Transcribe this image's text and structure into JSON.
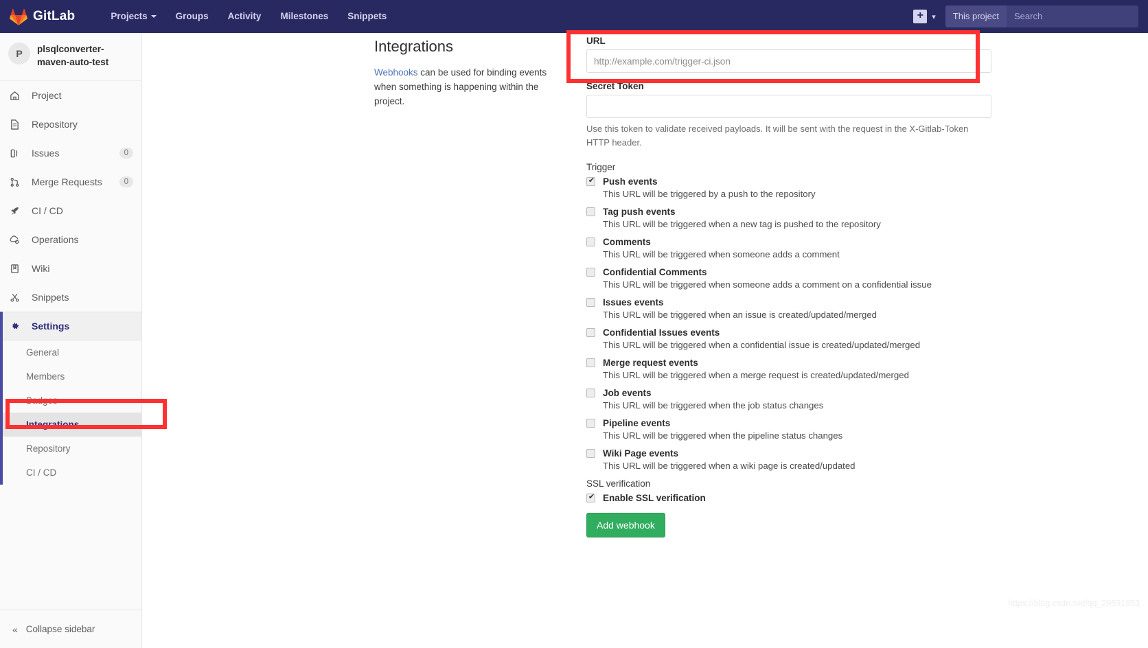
{
  "navbar": {
    "brand": "GitLab",
    "logo_icon": "gitlab-fox-logo",
    "links": [
      {
        "label": "Projects",
        "has_caret": true
      },
      {
        "label": "Groups",
        "has_caret": false
      },
      {
        "label": "Activity",
        "has_caret": false
      },
      {
        "label": "Milestones",
        "has_caret": false
      },
      {
        "label": "Snippets",
        "has_caret": false
      }
    ],
    "plus_icon": "plus-square-icon",
    "plus_caret_icon": "chevron-down-icon",
    "search_scope": "This project",
    "search_placeholder": "Search"
  },
  "sidebar": {
    "project_initial": "P",
    "project_name": "plsqlconverter-maven-auto-test",
    "items": [
      {
        "label": "Project",
        "icon": "home-icon",
        "count": null
      },
      {
        "label": "Repository",
        "icon": "document-icon",
        "count": null
      },
      {
        "label": "Issues",
        "icon": "issues-icon",
        "count": "0"
      },
      {
        "label": "Merge Requests",
        "icon": "merge-request-icon",
        "count": "0"
      },
      {
        "label": "CI / CD",
        "icon": "rocket-icon",
        "count": null
      },
      {
        "label": "Operations",
        "icon": "cloud-gear-icon",
        "count": null
      },
      {
        "label": "Wiki",
        "icon": "book-icon",
        "count": null
      },
      {
        "label": "Snippets",
        "icon": "scissors-icon",
        "count": null
      },
      {
        "label": "Settings",
        "icon": "gear-icon",
        "count": null,
        "active": true
      }
    ],
    "settings_subitems": [
      {
        "label": "General",
        "current": false
      },
      {
        "label": "Members",
        "current": false
      },
      {
        "label": "Badges",
        "current": false
      },
      {
        "label": "Integrations",
        "current": true
      },
      {
        "label": "Repository",
        "current": false
      },
      {
        "label": "CI / CD",
        "current": false
      }
    ],
    "collapse_label": "Collapse sidebar",
    "collapse_icon": "double-chevron-left-icon"
  },
  "main": {
    "page_title": "Integrations",
    "intro_link": "Webhooks",
    "intro_text": " can be used for binding events when something is happening within the project.",
    "url_label": "URL",
    "url_value": "",
    "url_placeholder": "http://example.com/trigger-ci.json",
    "secret_token_label": "Secret Token",
    "secret_token_value": "",
    "secret_token_help": "Use this token to validate received payloads. It will be sent with the request in the X-Gitlab-Token HTTP header.",
    "trigger_label": "Trigger",
    "triggers": [
      {
        "title": "Push events",
        "desc": "This URL will be triggered by a push to the repository",
        "checked": true
      },
      {
        "title": "Tag push events",
        "desc": "This URL will be triggered when a new tag is pushed to the repository",
        "checked": false
      },
      {
        "title": "Comments",
        "desc": "This URL will be triggered when someone adds a comment",
        "checked": false
      },
      {
        "title": "Confidential Comments",
        "desc": "This URL will be triggered when someone adds a comment on a confidential issue",
        "checked": false
      },
      {
        "title": "Issues events",
        "desc": "This URL will be triggered when an issue is created/updated/merged",
        "checked": false
      },
      {
        "title": "Confidential Issues events",
        "desc": "This URL will be triggered when a confidential issue is created/updated/merged",
        "checked": false
      },
      {
        "title": "Merge request events",
        "desc": "This URL will be triggered when a merge request is created/updated/merged",
        "checked": false
      },
      {
        "title": "Job events",
        "desc": "This URL will be triggered when the job status changes",
        "checked": false
      },
      {
        "title": "Pipeline events",
        "desc": "This URL will be triggered when the pipeline status changes",
        "checked": false
      },
      {
        "title": "Wiki Page events",
        "desc": "This URL will be triggered when a wiki page is created/updated",
        "checked": false
      }
    ],
    "ssl_label": "SSL verification",
    "ssl_checkbox_label": "Enable SSL verification",
    "ssl_checked": true,
    "submit_label": "Add webhook"
  },
  "annotations": {
    "highlight_color": "#fc3232",
    "url_box": "URL field highlight",
    "integrations_box": "Integrations sidebar item highlight"
  },
  "watermark": "https://blog.csdn.net/qq_29591953"
}
